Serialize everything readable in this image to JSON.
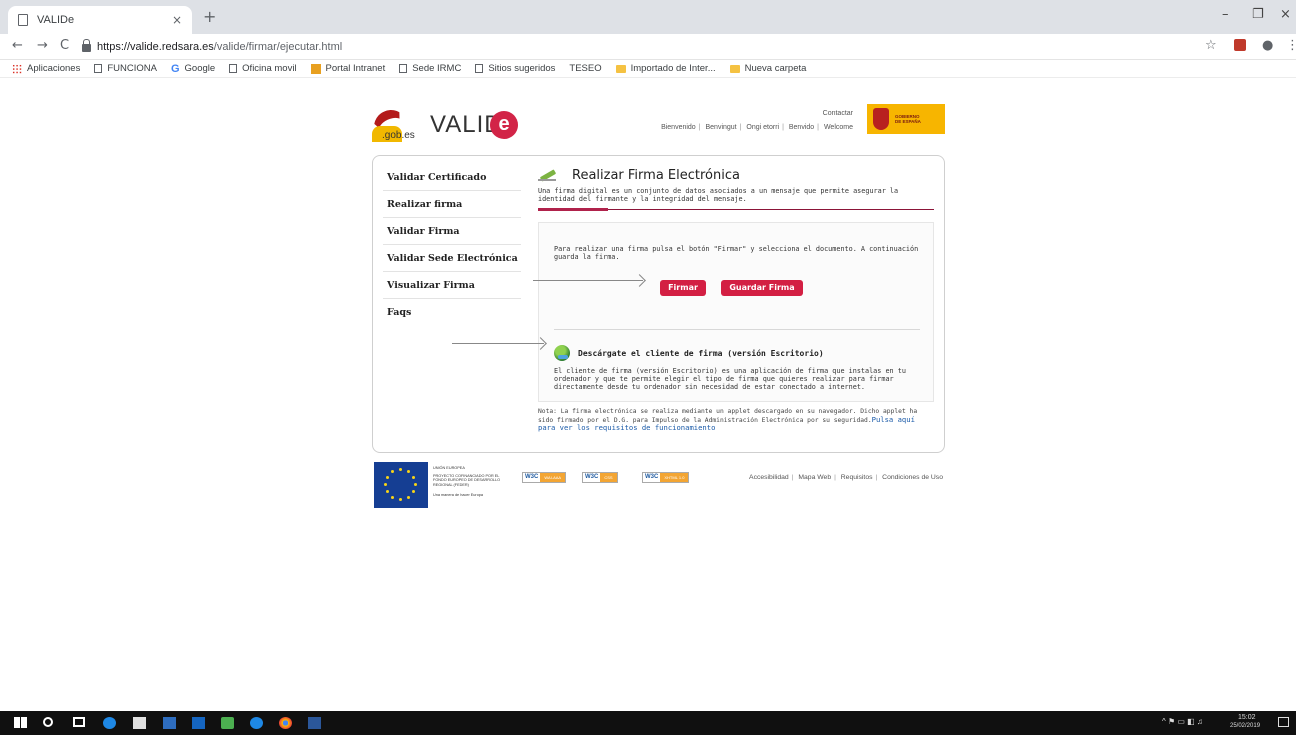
{
  "browser": {
    "tab_title": "VALIDe",
    "tab_close": "×",
    "new_tab": "+",
    "url_host": "https://valide.redsara.es",
    "url_path": "/valide/firmar/ejecutar.html",
    "nav_back": "←",
    "nav_forward": "→",
    "nav_reload": "C",
    "star": "☆",
    "profile": "●",
    "menu": "⋮",
    "window_minimize": "–",
    "window_maximize": "❐",
    "window_close": "×",
    "bookmarks": [
      {
        "label": "Aplicaciones",
        "icon": "apps-icon"
      },
      {
        "label": "FUNCIONA",
        "icon": "page-icon"
      },
      {
        "label": "Google",
        "icon": "google-icon"
      },
      {
        "label": "Oficina movil",
        "icon": "page-icon"
      },
      {
        "label": "Portal Intranet",
        "icon": "intranet-icon"
      },
      {
        "label": "Sede IRMC",
        "icon": "page-icon"
      },
      {
        "label": "Sitios sugeridos",
        "icon": "page-icon"
      },
      {
        "label": "TESEO",
        "icon": "none"
      },
      {
        "label": "Importado de Inter...",
        "icon": "folder-icon"
      },
      {
        "label": "Nueva carpeta",
        "icon": "folder-icon"
      }
    ]
  },
  "header": {
    "logo_gob": ".gob.es",
    "logo_text": "VALID",
    "logo_e": "e",
    "contact": "Contactar",
    "languages": [
      "Bienvenido",
      "Benvingut",
      "Ongi etorri",
      "Benvido",
      "Welcome"
    ],
    "gov_logo_text_1": "GOBIERNO",
    "gov_logo_text_2": "DE ESPAÑA"
  },
  "sidebar": {
    "items": [
      {
        "label": "Validar Certificado"
      },
      {
        "label": "Realizar firma"
      },
      {
        "label": "Validar Firma"
      },
      {
        "label": "Validar Sede Electrónica"
      },
      {
        "label": "Visualizar Firma"
      },
      {
        "label": "Faqs"
      }
    ]
  },
  "main": {
    "title": "Realizar Firma Electrónica",
    "description": "Una firma digital es un conjunto de datos asociados a un mensaje que permite asegurar la identidad del firmante y la integridad del mensaje.",
    "instructions": "Para realizar una firma pulsa el botón \"Firmar\" y selecciona el documento. A continuación guarda la firma.",
    "btn_firmar": "Firmar",
    "btn_guardar": "Guardar Firma",
    "download_title": "Descárgate el cliente de firma (versión Escritorio)",
    "download_text": "El cliente de firma (versión Escritorio) es una aplicación de firma que instalas en tu ordenador y que te permite elegir el tipo de firma que quieres realizar para firmar directamente desde tu ordenador sin necesidad de estar conectado a internet.",
    "note_text": "Nota: La firma electrónica se realiza mediante un applet descargado en su navegador. Dicho applet ha sido firmado por el D.G. para Impulso de la Administración Electrónica por su seguridad.",
    "note_link": "Pulsa aquí para ver los requisitos de funcionamiento"
  },
  "footer": {
    "eu_text_1": "UNIÓN EUROPEA",
    "eu_text_2": "PROYECTO COFINANCIADO POR EL FONDO EUROPEO DE DESARROLLO REGIONAL (FEDER)",
    "eu_text_3": "Una manera de hacer Europa",
    "badges": [
      {
        "w3c": "W3C",
        "label": "WAI-AAA"
      },
      {
        "w3c": "W3C",
        "label": "CSS"
      },
      {
        "w3c": "W3C",
        "label": "XHTML 1.0"
      }
    ],
    "links": [
      "Accesibilidad",
      "Mapa Web",
      "Requisitos",
      "Condiciones de Uso"
    ]
  },
  "taskbar": {
    "time": "15:02",
    "date": "25/02/2019"
  },
  "colors": {
    "accent": "#d31f43",
    "rule": "#8b1438",
    "link": "#1a5aa8"
  }
}
